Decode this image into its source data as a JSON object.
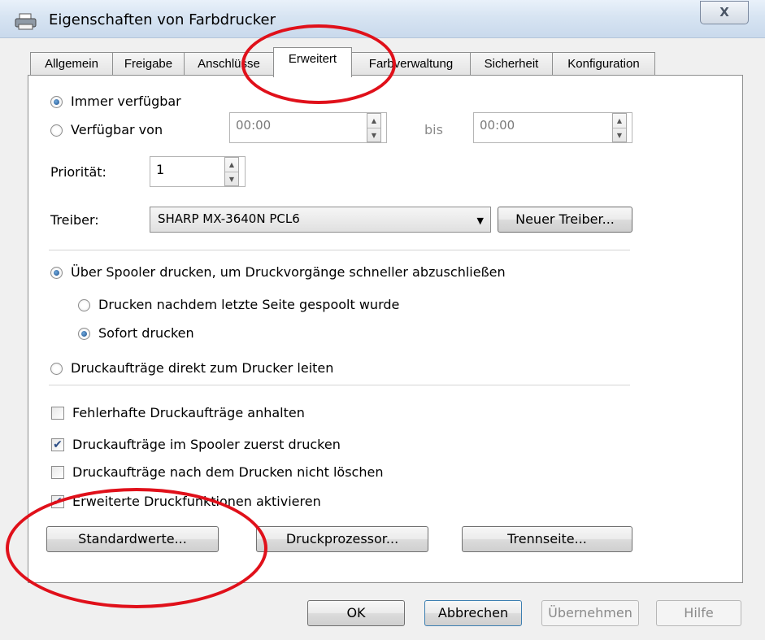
{
  "window": {
    "title": "Eigenschaften von Farbdrucker",
    "close_label": "X"
  },
  "tabs": [
    {
      "label": "Allgemein"
    },
    {
      "label": "Freigabe"
    },
    {
      "label": "Anschlüsse"
    },
    {
      "label": "Erweitert"
    },
    {
      "label": "Farbverwaltung"
    },
    {
      "label": "Sicherheit"
    },
    {
      "label": "Konfiguration"
    }
  ],
  "availability": {
    "always_label": "Immer verfügbar",
    "always_selected": true,
    "from_label": "Verfügbar von",
    "from_value": "00:00",
    "to_label": "bis",
    "to_value": "00:00"
  },
  "priority": {
    "label": "Priorität:",
    "value": "1"
  },
  "driver": {
    "label": "Treiber:",
    "selected": "SHARP MX-3640N PCL6",
    "new_button": "Neuer Treiber..."
  },
  "spooling": {
    "spool_label": "Über Spooler drucken, um Druckvorgänge schneller abzuschließen",
    "after_last_page_label": "Drucken nachdem letzte Seite gespoolt wurde",
    "immediately_label": "Sofort drucken",
    "direct_label": "Druckaufträge direkt zum Drucker leiten"
  },
  "options": [
    {
      "label": "Fehlerhafte Druckaufträge anhalten",
      "checked": false
    },
    {
      "label": "Druckaufträge im Spooler zuerst drucken",
      "checked": true
    },
    {
      "label": "Druckaufträge nach dem Drucken nicht löschen",
      "checked": false
    },
    {
      "label": "Erweiterte Druckfunktionen aktivieren",
      "checked": true
    }
  ],
  "panel_buttons": {
    "defaults": "Standardwerte...",
    "processor": "Druckprozessor...",
    "separator": "Trennseite..."
  },
  "dialog_buttons": {
    "ok": "OK",
    "cancel": "Abbrechen",
    "apply": "Übernehmen",
    "help": "Hilfe"
  },
  "annotation_color": "#e0101a"
}
